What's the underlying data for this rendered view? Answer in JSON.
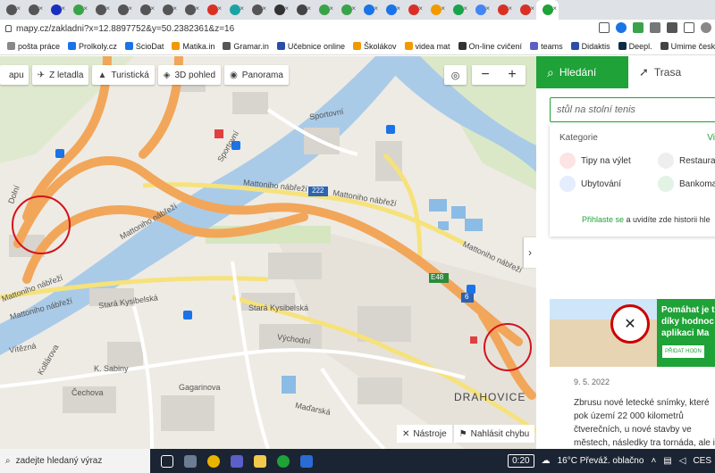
{
  "browser": {
    "tabs": [
      {
        "icon": "globe-icon",
        "color": "#555"
      },
      {
        "icon": "globe-icon",
        "color": "#555"
      },
      {
        "icon": "record-icon",
        "color": "#1a2fbf"
      },
      {
        "icon": "globe-icon",
        "color": "#3aa34a"
      },
      {
        "icon": "globe-icon",
        "color": "#555"
      },
      {
        "icon": "n-icon",
        "color": "#555"
      },
      {
        "icon": "globe-icon",
        "color": "#555"
      },
      {
        "icon": "globe-icon",
        "color": "#555"
      },
      {
        "icon": "globe-icon",
        "color": "#555"
      },
      {
        "icon": "g-icon",
        "color": "#d93025"
      },
      {
        "icon": "tile-icon",
        "color": "#1aa3a3"
      },
      {
        "icon": "app-icon",
        "color": "#555"
      },
      {
        "icon": "x-icon",
        "color": "#333"
      },
      {
        "icon": "grid-icon",
        "color": "#444"
      },
      {
        "icon": "globe-icon",
        "color": "#3aa34a"
      },
      {
        "icon": "globe-icon",
        "color": "#3aa34a"
      },
      {
        "icon": "boat-icon",
        "color": "#1a73e8"
      },
      {
        "icon": "boat-icon",
        "color": "#1a73e8"
      },
      {
        "icon": "cloud-icon",
        "color": "#d93025"
      },
      {
        "icon": "ball-icon",
        "color": "#f29900"
      },
      {
        "icon": "g-icon",
        "color": "#1aa34a"
      },
      {
        "icon": "g-icon",
        "color": "#4285f4"
      },
      {
        "icon": "flag-icon",
        "color": "#d93025"
      },
      {
        "icon": "o-icon",
        "color": "#d93025"
      },
      {
        "icon": "map-icon",
        "color": "#1fa237"
      }
    ],
    "url": "mapy.cz/zakladni?x=12.8897752&y=50.2382361&z=16",
    "bookmarks": [
      {
        "label": "pošta práce",
        "color": "#888"
      },
      {
        "label": "Prolkoly.cz",
        "color": "#1a73e8"
      },
      {
        "label": "ScioDat",
        "color": "#1a73e8"
      },
      {
        "label": "Matika.in",
        "color": "#f29900"
      },
      {
        "label": "Gramar.in",
        "color": "#555"
      },
      {
        "label": "Učebnice online",
        "color": "#2b4da8"
      },
      {
        "label": "Školákov",
        "color": "#f29900"
      },
      {
        "label": "videa mat",
        "color": "#f29900"
      },
      {
        "label": "On-line cvičení",
        "color": "#333"
      },
      {
        "label": "teams",
        "color": "#5b5fc7"
      },
      {
        "label": "Didaktis",
        "color": "#2b4da8"
      },
      {
        "label": "Deepl.",
        "color": "#0f2b46"
      },
      {
        "label": "Umime česky",
        "color": "#444"
      }
    ]
  },
  "map": {
    "toolbar": [
      "Z letadla",
      "Turistická",
      "3D pohled",
      "Panorama"
    ],
    "labels": {
      "sportovni1": "Sportovní",
      "sportovni2": "Sportovní",
      "matt1": "Mattoniho nábřeží",
      "matt2": "Mattoniho nábřeží",
      "matt3": "Mattoniho nábřeží",
      "matt4": "Mattoniho nábřeží",
      "matt5": "Mattoniho nábřeží",
      "matt6": "Mattoniho nábřeží",
      "dolni": "Dolní",
      "stara1": "Stará Kysibelská",
      "stara2": "Stará Kysibelská",
      "vychodni": "Východní",
      "kaplank": "K. Sabiny",
      "drahovice": "DRAHOVICE",
      "road222": "222",
      "e48": "E48",
      "six": "6",
      "kollar": "Kollárova",
      "celakov": "Čechova",
      "gagarin": "Gagarinova",
      "madarska": "Maďarská",
      "vitezna": "Vítězná",
      "nastroje": "Nástroje",
      "nahlasit": "Nahlásit chybu"
    }
  },
  "panel": {
    "tab_search": "Hledání",
    "tab_route": "Trasa",
    "search_value": "stůl na stolní tenis",
    "categories_title": "Kategorie",
    "categories_more": "Vic",
    "categories": [
      "Tipy na výlet",
      "Restaura",
      "Ubytování",
      "Bankoma"
    ],
    "login_link": "Přihlaste se",
    "login_text": "a uvidíte zde historii hle",
    "banner_title": "Pomáhat je t díky hodnoc v aplikaci Ma",
    "banner_button": "PŘIDAT HODN",
    "news_date": "9. 5. 2022",
    "news_text": "Zbrusu nové letecké snímky, které pok území 22 000 kilometrů čtverečních, u nové stavby ve městech, následky tra tornáda, ale i proměny přírody."
  },
  "taskbar": {
    "search_placeholder": "zadejte hledaný výraz",
    "time": "0:20",
    "weather": "16°C  Převáž. oblačno",
    "lang": "CES"
  }
}
